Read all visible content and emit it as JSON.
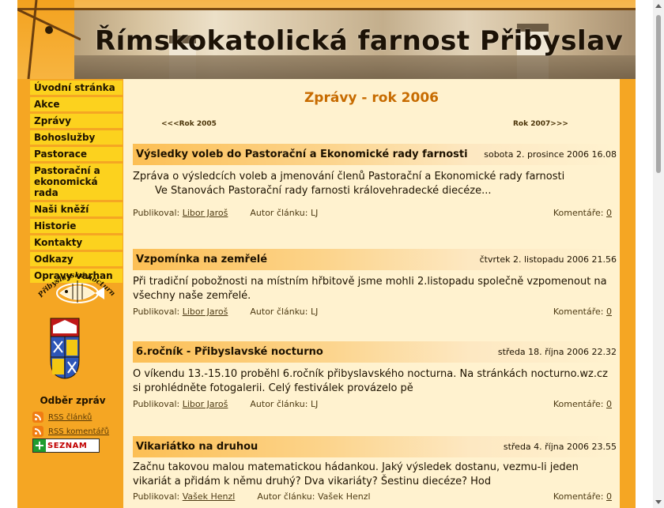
{
  "header": {
    "title": "Římskokatolická farnost Přibyslav"
  },
  "sidebar": {
    "items": [
      {
        "label": "Úvodní stránka"
      },
      {
        "label": "Akce"
      },
      {
        "label": "Zprávy"
      },
      {
        "label": "Bohoslužby"
      },
      {
        "label": "Pastorace"
      },
      {
        "label": "Pastorační a ekonomická rada"
      },
      {
        "label": "Naši kněží"
      },
      {
        "label": "Historie"
      },
      {
        "label": "Kontakty"
      },
      {
        "label": "Odkazy"
      },
      {
        "label": "Opravy varhan"
      }
    ],
    "logo_text": "Přibyslavské nocturno",
    "subscriptions_title": "Odběr zpráv",
    "rss_articles": "RSS článků",
    "rss_comments": "RSS komentářů",
    "seznam_label": "SEZNAM"
  },
  "content": {
    "heading": "Zprávy - rok 2006",
    "prev_link": "<<<Rok 2005",
    "next_link": "Rok 2007>>>",
    "labels": {
      "published_by": "Publikoval:",
      "article_author": "Autor článku:",
      "comments": "Komentáře:"
    },
    "articles": [
      {
        "title": "Výsledky voleb do Pastorační a Ekonomické rady farnosti",
        "date": "sobota 2. prosince 2006 16.08",
        "body1": "Zpráva o výsledcích voleb a jmenování členů Pastorační a Ekonomické rady farnosti",
        "body2": "Ve Stanovách Pastorační rady farnosti královehradecké diecéze...",
        "publisher": "Libor Jaroš",
        "author": "LJ",
        "comments": "0"
      },
      {
        "title": "Vzpomínka na zemřelé",
        "date": "čtvrtek 2. listopadu 2006 21.56",
        "body1": "Při tradiční pobožnosti na místním hřbitově jsme mohli 2.listopadu společně vzpomenout na všechny naše zemřelé.",
        "publisher": "Libor Jaroš",
        "author": "LJ",
        "comments": "0"
      },
      {
        "title": "6.ročník - Přibyslavské nocturno",
        "date": "středa 18. října 2006 22.32",
        "body1": "O víkendu 13.-15.10 proběhl 6.ročník přibyslavského nocturna. Na stránkách nocturno.wz.cz si prohlédněte fotogalerii. Celý festiválek provázelo pě",
        "publisher": "Libor Jaroš",
        "author": "LJ",
        "comments": "0"
      },
      {
        "title": "Vikariátko na druhou",
        "date": "středa 4. října 2006 23.55",
        "body1": "Začnu takovou malou matematickou hádankou. Jaký výsledek dostanu, vezmu-li jeden vikariát a přidám k němu druhý? Dva vikariáty? Šestinu diecéze? Hod",
        "publisher": "Vašek Henzl",
        "author": "Vašek Henzl",
        "comments": "0"
      }
    ]
  }
}
